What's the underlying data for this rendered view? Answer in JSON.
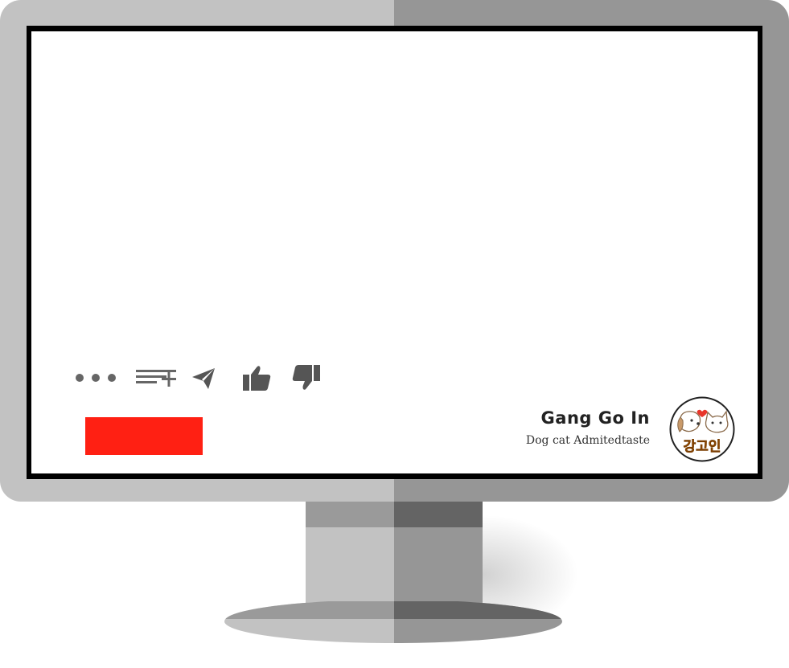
{
  "brand": {
    "title": "Gang Go In",
    "subtitle": "Dog cat Admitedtaste",
    "logo_text": "강고인"
  },
  "toolbar": {
    "icons": [
      "more-icon",
      "add-to-playlist-icon",
      "share-icon",
      "thumbs-up-icon",
      "thumbs-down-icon"
    ]
  },
  "colors": {
    "accent": "#ff2013",
    "icon": "#555555",
    "bezel_light": "#c2c2c2",
    "bezel_dark": "#969696",
    "logo_orange": "#e8851a"
  }
}
